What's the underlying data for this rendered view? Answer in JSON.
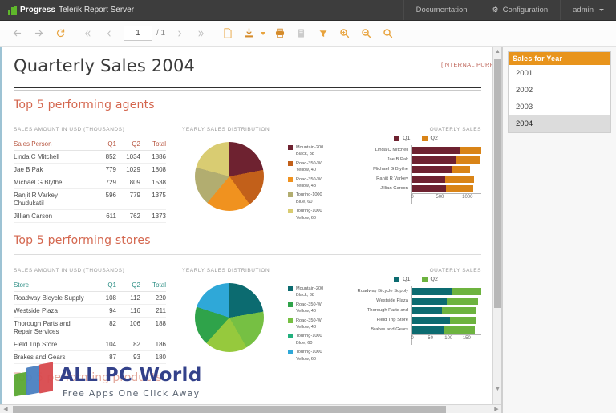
{
  "header": {
    "brand_name": "Progress",
    "brand_sub": "Telerik Report Server",
    "nav": [
      {
        "label": "Documentation",
        "icon": ""
      },
      {
        "label": "Configuration",
        "icon": "gear-icon"
      },
      {
        "label": "admin",
        "icon": "caret-down-icon"
      }
    ]
  },
  "toolbar": {
    "back": "←",
    "forward": "→",
    "refresh": "⟳",
    "first": "«",
    "prev": "‹",
    "page_value": "1",
    "page_of": "/ 1",
    "next": "›",
    "last": "»",
    "page_icon": "☐",
    "export": "⤓",
    "print": "⎙",
    "doc": "▤",
    "filter": "▼",
    "zoom_in": "⌕",
    "zoom_out": "⌕",
    "search": "⌕",
    "labels": {
      "back": "Back",
      "forward": "Forward",
      "refresh": "Refresh",
      "first": "First page",
      "prev": "Previous page",
      "next": "Next page",
      "last": "Last page",
      "page": "Page number",
      "page_icon": "Page setup",
      "export": "Export",
      "print": "Print",
      "doc": "Document map",
      "filter": "Toggle parameters",
      "zoom_in": "Zoom in",
      "zoom_out": "Zoom out",
      "search": "Search"
    }
  },
  "report": {
    "title": "Quarterly Sales 2004",
    "note": "[INTERNAL PURP",
    "sections": [
      {
        "title": "Top 5 performing agents",
        "table_caption": "SALES AMOUNT IN USD (THOUSANDS)",
        "pie_caption": "YEARLY SALES DISTRIBUTION",
        "bar_caption": "QUATERLY SALES",
        "name_header": "Sales Person",
        "headers": [
          "Q1",
          "Q2",
          "Total"
        ],
        "rows": [
          {
            "name": "Linda C Mitchell",
            "q1": "852",
            "q2": "1034",
            "total": "1886"
          },
          {
            "name": "Jae B Pak",
            "q1": "779",
            "q2": "1029",
            "total": "1808"
          },
          {
            "name": "Michael G Blythe",
            "q1": "729",
            "q2": "809",
            "total": "1538"
          },
          {
            "name": "Ranjit R Varkey Chudukatil",
            "q1": "596",
            "q2": "779",
            "total": "1375"
          },
          {
            "name": "Jillian  Carson",
            "q1": "611",
            "q2": "762",
            "total": "1373"
          }
        ],
        "legend": [
          {
            "l1": "Mountain-200",
            "l2": "Black, 38",
            "color": "#6e2230"
          },
          {
            "l1": "Road-350-W",
            "l2": "Yellow, 40",
            "color": "#c2601a"
          },
          {
            "l1": "Road-350-W",
            "l2": "Yellow, 48",
            "color": "#f0921f"
          },
          {
            "l1": "Touring-1000",
            "l2": "Blue, 60",
            "color": "#b2ad70"
          },
          {
            "l1": "Touring-1000",
            "l2": "Yellow, 60",
            "color": "#d9cc72"
          }
        ],
        "bar_legend": [
          {
            "label": "Q1",
            "color": "#6e2230"
          },
          {
            "label": "Q2",
            "color": "#d98417"
          }
        ],
        "axis_ticks": [
          "0",
          "500",
          "1000"
        ],
        "axis_max": 1250
      },
      {
        "title": "Top 5 performing stores",
        "table_caption": "SALES AMOUNT IN USD (THOUSANDS)",
        "pie_caption": "YEARLY SALES DISTRIBUTION",
        "bar_caption": "QUATERLY SALES",
        "name_header": "Store",
        "headers": [
          "Q1",
          "Q2",
          "Total"
        ],
        "rows": [
          {
            "name": "Roadway Bicycle Supply",
            "q1": "108",
            "q2": "112",
            "total": "220"
          },
          {
            "name": "Westside Plaza",
            "q1": "94",
            "q2": "116",
            "total": "211"
          },
          {
            "name": "Thorough Parts and Repair Services",
            "q1": "82",
            "q2": "106",
            "total": "188"
          },
          {
            "name": "Field Trip Store",
            "q1": "104",
            "q2": "82",
            "total": "186"
          },
          {
            "name": "Brakes and Gears",
            "q1": "87",
            "q2": "93",
            "total": "180"
          }
        ],
        "legend": [
          {
            "l1": "Mountain-200",
            "l2": "Black, 38",
            "color": "#0c6b70"
          },
          {
            "l1": "Road-350-W",
            "l2": "Yellow, 40",
            "color": "#2fa34a"
          },
          {
            "l1": "Road-350-W",
            "l2": "Yellow, 48",
            "color": "#76c043"
          },
          {
            "l1": "Touring-1000",
            "l2": "Blue, 60",
            "color": "#22b07d"
          },
          {
            "l1": "Touring-1000",
            "l2": "Yellow, 60",
            "color": "#2fa8d8"
          }
        ],
        "bar_legend": [
          {
            "label": "Q1",
            "color": "#0c6b70"
          },
          {
            "label": "Q2",
            "color": "#6db33f"
          }
        ],
        "axis_ticks": [
          "0",
          "50",
          "100",
          "150"
        ],
        "axis_max": 190
      }
    ],
    "products_title": "Top 5 performing products"
  },
  "chart_data": [
    {
      "type": "pie",
      "title": "YEARLY SALES DISTRIBUTION",
      "section": "Top 5 performing agents",
      "categories": [
        "Mountain-200 Black, 38",
        "Road-350-W Yellow, 40",
        "Road-350-W Yellow, 48",
        "Touring-1000 Blue, 60",
        "Touring-1000 Yellow, 60"
      ],
      "values": [
        22,
        18,
        21,
        18,
        21
      ],
      "colors": [
        "#6e2230",
        "#c2601a",
        "#f0921f",
        "#b2ad70",
        "#d9cc72"
      ],
      "legend_position": "right"
    },
    {
      "type": "bar",
      "orientation": "horizontal",
      "stacked": true,
      "title": "QUATERLY SALES",
      "section": "Top 5 performing agents",
      "categories": [
        "Linda C Mitchell",
        "Jae B Pak",
        "Michael G Blythe",
        "Ranjit R Varkey",
        "Jillian  Carson"
      ],
      "series": [
        {
          "name": "Q1",
          "values": [
            852,
            779,
            729,
            596,
            611
          ],
          "color": "#6e2230"
        },
        {
          "name": "Q2",
          "values": [
            1034,
            1029,
            809,
            779,
            762
          ],
          "color": "#d98417"
        }
      ],
      "xlabel": "",
      "ylabel": "",
      "xlim": [
        0,
        1250
      ],
      "ticks": [
        0,
        500,
        1000
      ],
      "grid": false,
      "legend_position": "top"
    },
    {
      "type": "pie",
      "title": "YEARLY SALES DISTRIBUTION",
      "section": "Top 5 performing stores",
      "categories": [
        "Mountain-200 Black, 38",
        "Road-350-W Yellow, 40",
        "Road-350-W Yellow, 48",
        "Touring-1000 Blue, 60",
        "Touring-1000 Yellow, 60"
      ],
      "values": [
        22,
        20,
        20,
        18,
        20
      ],
      "colors": [
        "#0c6b70",
        "#76c043",
        "#96c93d",
        "#2fa34a",
        "#2fa8d8"
      ],
      "legend_position": "right"
    },
    {
      "type": "bar",
      "orientation": "horizontal",
      "stacked": true,
      "title": "QUATERLY SALES",
      "section": "Top 5 performing stores",
      "categories": [
        "Roadway Bicycle Supply",
        "Westside Plaza",
        "Thorough Parts and",
        "Field Trip Store",
        "Brakes and Gears"
      ],
      "series": [
        {
          "name": "Q1",
          "values": [
            108,
            94,
            82,
            104,
            87
          ],
          "color": "#0c6b70"
        },
        {
          "name": "Q2",
          "values": [
            112,
            116,
            106,
            82,
            93
          ],
          "color": "#6db33f"
        }
      ],
      "xlabel": "",
      "ylabel": "",
      "xlim": [
        0,
        190
      ],
      "ticks": [
        0,
        50,
        100,
        150
      ],
      "grid": false,
      "legend_position": "top"
    }
  ],
  "parameters": {
    "header": "Sales for Year",
    "options": [
      "2001",
      "2002",
      "2003",
      "2004"
    ],
    "selected": "2004"
  },
  "watermark": {
    "title": "ALL PC World",
    "subtitle": "Free Apps One Click Away"
  }
}
